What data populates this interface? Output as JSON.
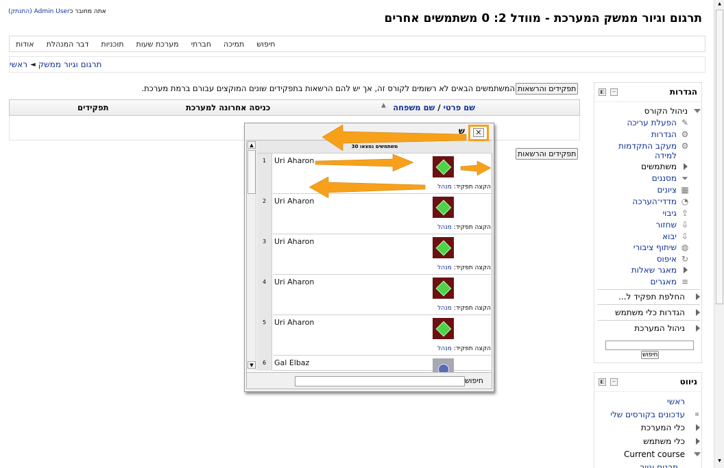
{
  "header": {
    "login_prefix": "אתה מחובר כ",
    "login_user": "Admin User",
    "logout": "(התנתק)",
    "title": "תרגום וגיור ממשק המערכת - מוודל 2: 0 משתמשים אחרים"
  },
  "menu": [
    "אודות",
    "דבר המנהלת",
    "תוכניות",
    "מערכת שעות",
    "חברתי",
    "תמיכה",
    "חיפוש"
  ],
  "breadcrumb": {
    "home": "ראשי",
    "sep": "◄",
    "current": "תרגום וגיור ממשק"
  },
  "main": {
    "roles_button": "תפקידים והרשאות",
    "notice": "המשתמשים הבאים לא רשומים לקורס זה, אך יש להם הרשאות בתפקידים שונים המוקצים עבורם ברמת מערכת.",
    "columns": {
      "firstname": "שם פרטי",
      "slash": " / ",
      "lastname": "שם משפחה",
      "lastaccess": "כניסה אחרונה למערכת",
      "roles": "תפקידים"
    }
  },
  "popup": {
    "title_fragment": "ש",
    "close": "✕",
    "found_label": "30 משתמשים נמצאו",
    "role_label": "הקצה תפקיד:",
    "role_value": "מנהל",
    "search_label": "חיפוש",
    "users": [
      {
        "num": "1",
        "name": "Uri Aharon",
        "avatar": "default"
      },
      {
        "num": "2",
        "name": "Uri Aharon",
        "avatar": "default"
      },
      {
        "num": "3",
        "name": "Uri Aharon",
        "avatar": "default"
      },
      {
        "num": "4",
        "name": "Uri Aharon",
        "avatar": "default"
      },
      {
        "num": "5",
        "name": "Uri Aharon",
        "avatar": "default"
      },
      {
        "num": "6",
        "name": "Gal Elbaz",
        "avatar": "photo"
      }
    ]
  },
  "settings_block": {
    "title": "הגדרות",
    "course_admin": "ניהול הקורס",
    "items": [
      "הפעלת עריכה",
      "הגדרות",
      "מעקב התקדמות",
      "למידה",
      "משתמשים",
      "מסננים",
      "ציונים",
      "מדדי־הערכה",
      "גיבוי",
      "שחזור",
      "יבוא",
      "שיתוף ציבורי",
      "איפוס",
      "מאגר שאלות",
      "מאגרים"
    ],
    "switch_role": "החלפת תפקיד ל...",
    "user_settings": "הגדרות כלי משתמש",
    "site_admin": "ניהול המערכת",
    "search_button": "חיפוש"
  },
  "nav_block": {
    "title": "ניווט",
    "items": [
      "ראשי",
      "עדכונים בקורסים שלי",
      "כלי המערכת",
      "כלי משתמש",
      "Current course",
      "תרגום וגיור"
    ]
  }
}
